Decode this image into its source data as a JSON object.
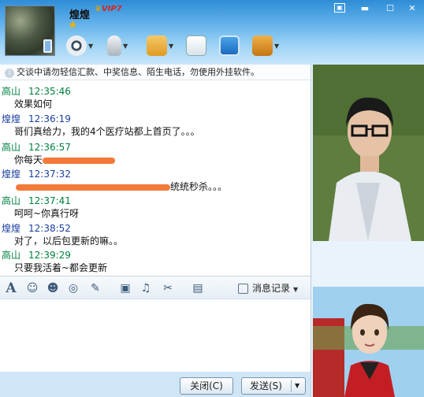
{
  "contact": {
    "name": "煌煌",
    "vip_label": "VIP7"
  },
  "window": {
    "menu_icon": "▣",
    "min_icon": "▬",
    "max_icon": "☐",
    "close_icon": "✕"
  },
  "notice": "交谈中请勿轻信汇款、中奖信息、陌生电话，勿使用外挂软件。",
  "messages": [
    {
      "sender": "高山",
      "time": "12:35:46",
      "text": "效果如何",
      "kind": "gs"
    },
    {
      "sender": "煌煌",
      "time": "12:36:19",
      "text": "哥们真给力，我的4个医疗站都上首页了。。。",
      "kind": "hh"
    },
    {
      "sender": "高山",
      "time": "12:36:57",
      "text": "你每天",
      "kind": "gs"
    },
    {
      "sender": "煌煌",
      "time": "12:37:32",
      "text": "统统秒杀。。。",
      "kind": "hh"
    },
    {
      "sender": "高山",
      "time": "12:37:41",
      "text": "呵呵~你真行呀",
      "kind": "gs"
    },
    {
      "sender": "煌煌",
      "time": "12:38:52",
      "text": "对了，以后包更新的嘛。。",
      "kind": "hh"
    },
    {
      "sender": "高山",
      "time": "12:39:29",
      "text": "只要我活着~都会更新",
      "kind": "gs"
    }
  ],
  "format_bar": {
    "history_label": "消息记录"
  },
  "buttons": {
    "close": "关闭(C)",
    "send": "发送(S)"
  },
  "colors": {
    "self_name": "#1a3f9e",
    "peer_name": "#008040",
    "redaction": "#f37a38"
  }
}
